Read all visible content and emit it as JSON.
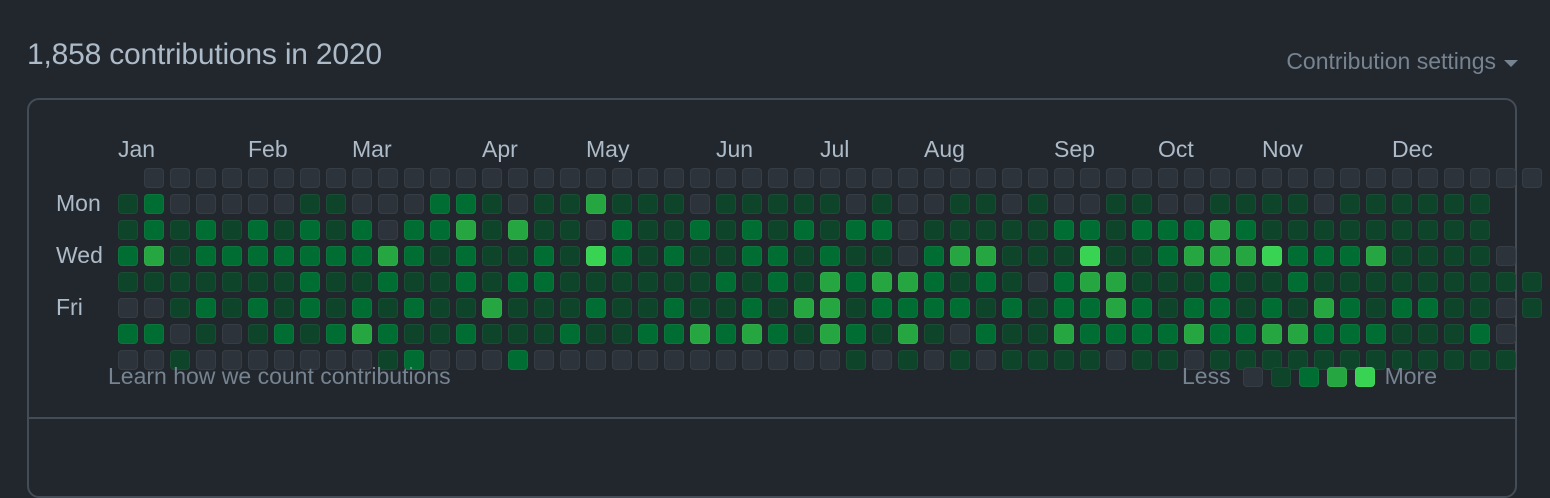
{
  "heading": "1,858 contributions in 2020",
  "settings_label": "Contribution settings",
  "months": [
    "Jan",
    "Feb",
    "Mar",
    "Apr",
    "May",
    "Jun",
    "Jul",
    "Aug",
    "Sep",
    "Oct",
    "Nov",
    "Dec"
  ],
  "days": [
    "Mon",
    "Wed",
    "Fri"
  ],
  "footer_link": "Learn how we count contributions",
  "legend": {
    "less": "Less",
    "more": "More"
  },
  "colors": [
    "#2d333b",
    "#0e4429",
    "#006d32",
    "#26a641",
    "#39d353"
  ],
  "levels": [
    [
      -1,
      0,
      0,
      0,
      0,
      0,
      0,
      0,
      0,
      0,
      0,
      0,
      0,
      0,
      0,
      0,
      0,
      0,
      0,
      0,
      0,
      0,
      0,
      0,
      0,
      0,
      0,
      0,
      0,
      0,
      0,
      0,
      0,
      0,
      0,
      0,
      0,
      0,
      0,
      0,
      0,
      0,
      0,
      0,
      0,
      0,
      0,
      0,
      0,
      0,
      0,
      0,
      0,
      0,
      0
    ],
    [
      1,
      2,
      0,
      0,
      0,
      0,
      0,
      1,
      1,
      0,
      0,
      0,
      2,
      2,
      1,
      0,
      1,
      1,
      3,
      1,
      1,
      1,
      0,
      1,
      1,
      1,
      1,
      1,
      0,
      1,
      0,
      0,
      1,
      1,
      0,
      1,
      0,
      0,
      1,
      1,
      0,
      0,
      1,
      1,
      1,
      1,
      0,
      1,
      1,
      1,
      1,
      1,
      1
    ],
    [
      1,
      2,
      1,
      2,
      1,
      2,
      1,
      2,
      1,
      2,
      0,
      2,
      2,
      3,
      1,
      3,
      1,
      1,
      0,
      2,
      1,
      1,
      2,
      1,
      2,
      1,
      2,
      1,
      2,
      2,
      0,
      1,
      1,
      1,
      1,
      1,
      2,
      2,
      1,
      2,
      2,
      2,
      3,
      2,
      1,
      1,
      1,
      1,
      1,
      1,
      1,
      1,
      1
    ],
    [
      2,
      3,
      1,
      2,
      2,
      2,
      2,
      2,
      2,
      2,
      3,
      2,
      1,
      2,
      1,
      1,
      2,
      1,
      4,
      2,
      1,
      2,
      1,
      1,
      2,
      2,
      1,
      2,
      1,
      1,
      0,
      2,
      3,
      3,
      1,
      1,
      1,
      4,
      1,
      1,
      2,
      3,
      3,
      3,
      4,
      2,
      2,
      2,
      3,
      1,
      1,
      1,
      1,
      0
    ],
    [
      1,
      1,
      1,
      1,
      1,
      1,
      1,
      2,
      1,
      1,
      2,
      1,
      1,
      2,
      1,
      2,
      2,
      1,
      1,
      1,
      1,
      1,
      1,
      2,
      1,
      2,
      1,
      3,
      2,
      3,
      3,
      2,
      1,
      2,
      1,
      0,
      2,
      3,
      3,
      1,
      1,
      1,
      2,
      1,
      1,
      2,
      1,
      1,
      1,
      1,
      1,
      1,
      1,
      1,
      1
    ],
    [
      0,
      0,
      1,
      2,
      1,
      2,
      1,
      2,
      1,
      2,
      1,
      2,
      1,
      1,
      3,
      1,
      1,
      1,
      2,
      1,
      1,
      2,
      1,
      1,
      2,
      1,
      3,
      3,
      1,
      2,
      2,
      2,
      2,
      1,
      2,
      1,
      2,
      2,
      3,
      2,
      1,
      2,
      2,
      1,
      2,
      1,
      3,
      2,
      1,
      2,
      2,
      1,
      1,
      0,
      1
    ],
    [
      2,
      2,
      0,
      1,
      0,
      1,
      2,
      1,
      2,
      3,
      2,
      1,
      1,
      2,
      1,
      1,
      1,
      2,
      1,
      1,
      2,
      2,
      3,
      2,
      3,
      2,
      1,
      3,
      2,
      1,
      3,
      1,
      0,
      2,
      1,
      1,
      3,
      2,
      2,
      2,
      2,
      3,
      2,
      2,
      3,
      3,
      2,
      2,
      2,
      1,
      1,
      1,
      2,
      0
    ],
    [
      0,
      0,
      1,
      0,
      0,
      0,
      0,
      0,
      0,
      0,
      1,
      2,
      0,
      0,
      0,
      2,
      0,
      0,
      0,
      0,
      0,
      0,
      0,
      0,
      0,
      0,
      0,
      0,
      1,
      0,
      1,
      0,
      1,
      0,
      1,
      1,
      1,
      1,
      0,
      1,
      1,
      0,
      1,
      1,
      1,
      1,
      1,
      1,
      1,
      1,
      1,
      1,
      1,
      1
    ]
  ]
}
